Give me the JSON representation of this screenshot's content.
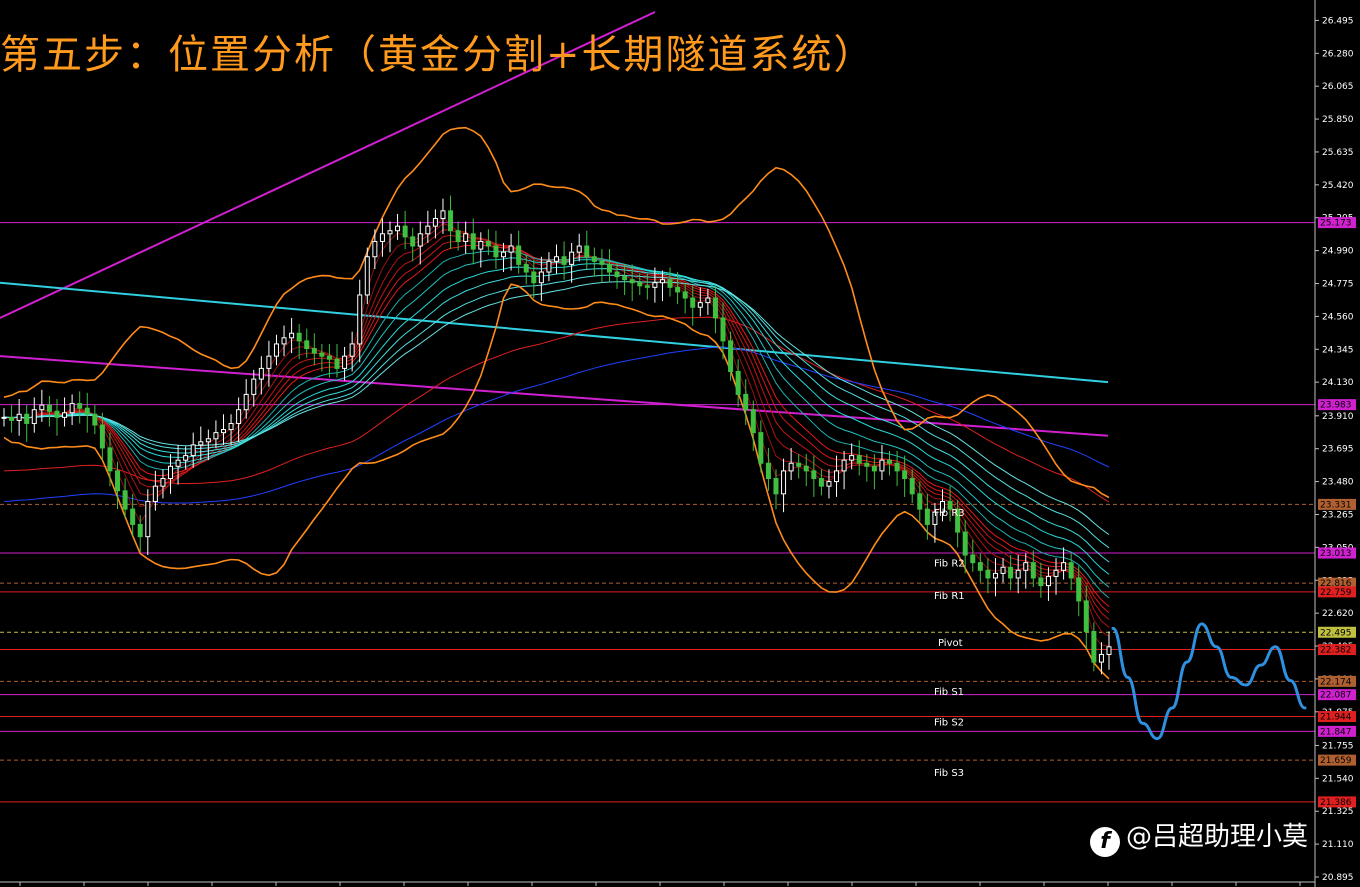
{
  "title": "第五步：位置分析（黄金分割+长期隧道系统）",
  "watermark": "@吕超助理小莫",
  "colors": {
    "background": "#000000",
    "title": "#ff9a1e",
    "bollinger": "#ff8c1a",
    "channel_magenta": "#d020d0",
    "cyan_line": "#30d0e0",
    "ma_red": "#e02020",
    "ma_blue": "#2040ff",
    "candle_up": "#ffffff",
    "candle_down": "#40c040",
    "projection": "#3090e0"
  },
  "chart_data": {
    "type": "candlestick",
    "title": "第五步：位置分析（黄金分割+长期隧道系统）",
    "y_axis_ticks": [
      "26.495",
      "26.280",
      "26.065",
      "25.850",
      "25.635",
      "25.420",
      "25.205",
      "24.990",
      "24.775",
      "24.560",
      "24.345",
      "24.130",
      "23.910",
      "23.695",
      "23.480",
      "23.265",
      "23.050",
      "22.835",
      "22.620",
      "22.405",
      "22.190",
      "21.975",
      "21.755",
      "21.540",
      "21.325",
      "21.110",
      "20.895"
    ],
    "ylim": [
      20.895,
      26.55
    ],
    "horizontal_levels": [
      {
        "value": 25.173,
        "label": "25.173",
        "color": "#d020d0",
        "style": "solid"
      },
      {
        "value": 23.983,
        "label": "23.983",
        "color": "#d020d0",
        "style": "solid"
      },
      {
        "value": 23.331,
        "label": "23.331",
        "color": "#b06030",
        "style": "dashed"
      },
      {
        "value": 23.013,
        "label": "23.013",
        "color": "#d020d0",
        "style": "solid"
      },
      {
        "value": 22.816,
        "label": "22.816",
        "color": "#b06030",
        "style": "dashed"
      },
      {
        "value": 22.759,
        "label": "22.759",
        "color": "#e02020",
        "style": "solid"
      },
      {
        "value": 22.495,
        "label": "22.495",
        "color": "#c0c040",
        "style": "dashed"
      },
      {
        "value": 22.382,
        "label": "22.382",
        "color": "#e02020",
        "style": "solid"
      },
      {
        "value": 22.174,
        "label": "22.174",
        "color": "#b06030",
        "style": "dashed"
      },
      {
        "value": 22.087,
        "label": "22.087",
        "color": "#d020d0",
        "style": "solid"
      },
      {
        "value": 21.944,
        "label": "21.944",
        "color": "#e02020",
        "style": "solid"
      },
      {
        "value": 21.847,
        "label": "21.847",
        "color": "#d020d0",
        "style": "solid"
      },
      {
        "value": 21.659,
        "label": "21.659",
        "color": "#b06030",
        "style": "dashed"
      },
      {
        "value": 21.386,
        "label": "21.386",
        "color": "#e02020",
        "style": "solid"
      }
    ],
    "fib_labels": [
      {
        "label": "Fib R3",
        "value": 23.28
      },
      {
        "label": "Fib R2",
        "value": 22.95
      },
      {
        "label": "Fib R1",
        "value": 22.74
      },
      {
        "label": "Pivot",
        "value": 22.43
      },
      {
        "label": "Fib S1",
        "value": 22.11
      },
      {
        "label": "Fib S2",
        "value": 21.91
      },
      {
        "label": "Fib S3",
        "value": 21.58
      }
    ],
    "closes": [
      23.9,
      23.88,
      23.92,
      23.86,
      23.95,
      23.98,
      23.94,
      23.9,
      23.93,
      23.99,
      23.96,
      23.92,
      23.85,
      23.7,
      23.55,
      23.42,
      23.3,
      23.2,
      23.12,
      23.35,
      23.45,
      23.5,
      23.58,
      23.62,
      23.65,
      23.72,
      23.74,
      23.76,
      23.8,
      23.82,
      23.86,
      23.95,
      24.05,
      24.15,
      24.22,
      24.3,
      24.38,
      24.42,
      24.45,
      24.4,
      24.35,
      24.32,
      24.3,
      24.28,
      24.22,
      24.3,
      24.38,
      24.7,
      24.95,
      25.05,
      25.1,
      25.12,
      25.15,
      25.08,
      25.02,
      25.1,
      25.15,
      25.2,
      25.25,
      25.12,
      25.05,
      25.1,
      25.0,
      25.05,
      25.02,
      24.95,
      24.98,
      25.02,
      24.9,
      24.85,
      24.78,
      24.85,
      24.92,
      24.95,
      24.9,
      24.98,
      25.02,
      24.95,
      24.92,
      24.9,
      24.85,
      24.82,
      24.8,
      24.78,
      24.76,
      24.75,
      24.78,
      24.8,
      24.75,
      24.72,
      24.68,
      24.62,
      24.65,
      24.68,
      24.55,
      24.4,
      24.2,
      24.05,
      23.95,
      23.8,
      23.6,
      23.5,
      23.4,
      23.55,
      23.6,
      23.58,
      23.55,
      23.5,
      23.45,
      23.48,
      23.55,
      23.62,
      23.65,
      23.6,
      23.58,
      23.55,
      23.62,
      23.6,
      23.55,
      23.5,
      23.4,
      23.3,
      23.2,
      23.28,
      23.35,
      23.3,
      23.15,
      23.0,
      22.95,
      22.9,
      22.85,
      22.88,
      22.92,
      22.85,
      22.9,
      22.95,
      22.85,
      22.8,
      22.86,
      22.9,
      22.95,
      22.85,
      22.7,
      22.5,
      22.3,
      22.35,
      22.4
    ],
    "projection_path": [
      22.52,
      22.2,
      21.9,
      21.8,
      22.0,
      22.3,
      22.55,
      22.4,
      22.2,
      22.15,
      22.28,
      22.4,
      22.18,
      22.0
    ]
  }
}
